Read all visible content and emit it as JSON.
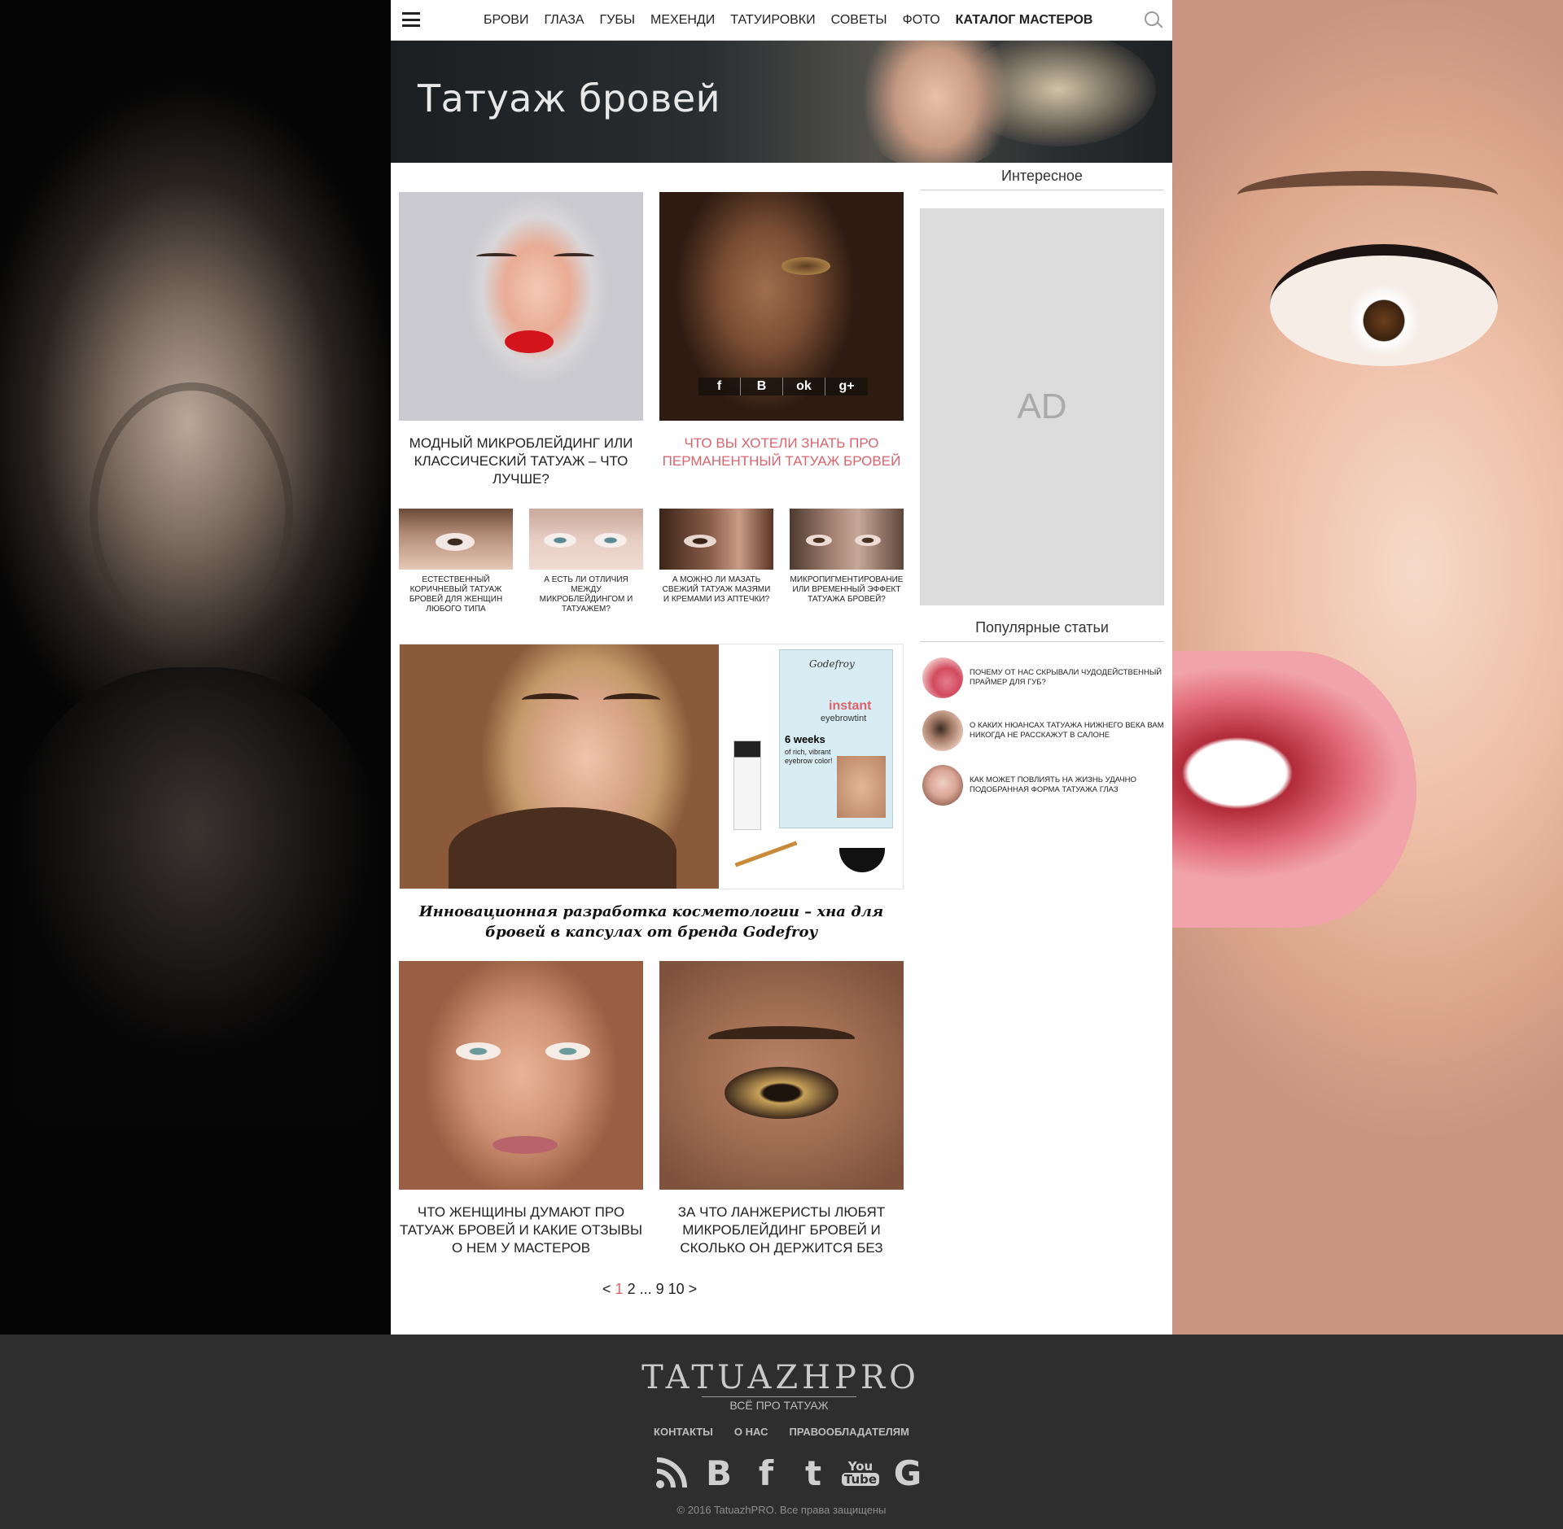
{
  "nav": {
    "items": [
      "БРОВИ",
      "ГЛАЗА",
      "ГУБЫ",
      "МЕХЕНДИ",
      "ТАТУИРОВКИ",
      "СОВЕТЫ",
      "ФОТО",
      "КАТАЛОГ МАСТЕРОВ"
    ],
    "menu_icon": "hamburger-icon",
    "search_icon": "search-icon"
  },
  "banner": {
    "title": "Татуаж бровей"
  },
  "articles_top": [
    {
      "title": "МОДНЫЙ МИКРОБЛЕЙДИНГ ИЛИ КЛАССИЧЕСКИЙ ТАТУАЖ – ЧТО ЛУЧШЕ?"
    },
    {
      "title": "ЧТО ВЫ ХОТЕЛИ ЗНАТЬ ПРО ПЕРМАНЕНТНЫЙ ТАТУАЖ БРОВЕЙ"
    }
  ],
  "share": {
    "facebook": "f",
    "vk": "B",
    "ok": "ok",
    "gplus": "g+"
  },
  "articles_small": [
    {
      "title": "ЕСТЕСТВЕННЫЙ КОРИЧНЕВЫЙ ТАТУАЖ БРОВЕЙ ДЛЯ ЖЕНЩИН ЛЮБОГО ТИПА"
    },
    {
      "title": "А ЕСТЬ ЛИ ОТЛИЧИЯ МЕЖДУ МИКРОБЛЕЙДИНГОМ И ТАТУАЖЕМ?"
    },
    {
      "title": "А МОЖНО ЛИ МАЗАТЬ СВЕЖИЙ ТАТУАЖ МАЗЯМИ И КРЕМАМИ ИЗ АПТЕЧКИ?"
    },
    {
      "title": "МИКРОПИГМЕНТИРОВАНИЕ ИЛИ ВРЕМЕННЫЙ ЭФФЕКТ ТАТУАЖА БРОВЕЙ?"
    }
  ],
  "feature": {
    "title": "Инновационная разработка косметологии – хна для бровей в капсулах от бренда Godefroy",
    "product": {
      "brand": "Godefroy",
      "line1": "instant",
      "line2": "eyebrowtint",
      "line3": "6 weeks",
      "line4": "of rich, vibrant eyebrow color!"
    }
  },
  "articles_bottom": [
    {
      "title": "ЧТО ЖЕНЩИНЫ ДУМАЮТ ПРО ТАТУАЖ БРОВЕЙ И КАКИЕ ОТЗЫВЫ О НЕМ У МАСТЕРОВ"
    },
    {
      "title": "ЗА ЧТО ЛАНЖЕРИСТЫ ЛЮБЯТ МИКРОБЛЕЙДИНГ БРОВЕЙ И СКОЛЬКО ОН ДЕРЖИТСЯ БЕЗ"
    }
  ],
  "pagination": {
    "prev": "<",
    "current": "1",
    "pages": "2 ... 9 10",
    "next": ">"
  },
  "sidebar": {
    "interesting_title": "Интересное",
    "ad_label": "AD",
    "popular_title": "Популярные статьи",
    "popular": [
      {
        "title": "ПОЧЕМУ ОТ НАС СКРЫВАЛИ ЧУДОДЕЙСТВЕННЫЙ ПРАЙМЕР ДЛЯ ГУБ?"
      },
      {
        "title": "О КАКИХ НЮАНСАХ ТАТУАЖА НИЖНЕГО ВЕКА ВАМ НИКОГДА НЕ РАССКАЖУТ В САЛОНЕ"
      },
      {
        "title": "КАК МОЖЕТ ПОВЛИЯТЬ НА ЖИЗНЬ УДАЧНО ПОДОБРАННАЯ ФОРМА ТАТУАЖА ГЛАЗ"
      }
    ]
  },
  "footer": {
    "logo": "TATUAZHPRO",
    "tagline": "ВСЁ ПРО ТАТУАЖ",
    "links": [
      "КОНТАКТЫ",
      "О НАС",
      "ПРАВООБЛАДАТЕЛЯМ"
    ],
    "socials": [
      "rss-icon",
      "vk-icon",
      "facebook-icon",
      "twitter-icon",
      "youtube-icon",
      "google-icon"
    ],
    "copyright": "© 2016 TatuazhPRO. Все права защищены"
  },
  "colors": {
    "accent": "#d9646e",
    "footer_bg": "#2e2e2e",
    "ad_bg": "#dcdcdc"
  }
}
